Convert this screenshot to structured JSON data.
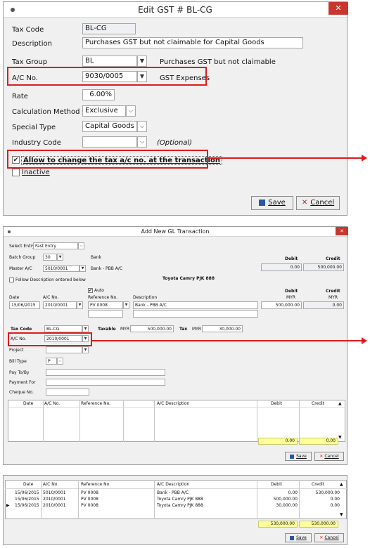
{
  "dialog1": {
    "title": "Edit GST # BL-CG",
    "close": "✕",
    "tax_code_label": "Tax Code",
    "tax_code_value": "BL-CG",
    "description_label": "Description",
    "description_value": "Purchases GST but not claimable for Capital Goods",
    "tax_group_label": "Tax Group",
    "tax_group_value": "BL",
    "tax_group_desc": "Purchases GST but not claimable",
    "ac_no_label": "A/C No.",
    "ac_no_value": "9030/0005",
    "ac_no_desc": "GST Expenses",
    "rate_label": "Rate",
    "rate_value": "6.00%",
    "calc_label": "Calculation Method",
    "calc_value": "Exclusive",
    "special_label": "Special Type",
    "special_value": "Capital Goods",
    "industry_label": "Industry Code",
    "industry_value": "",
    "optional": "(Optional)",
    "allow_change_label": "Allow to change the tax a/c no. at the transaction",
    "allow_change_checked": "✔",
    "inactive_label": "Inactive",
    "save_label": "Save",
    "cancel_label": "Cancel"
  },
  "dialog2": {
    "title": "Add New GL Transaction",
    "close": "✕",
    "select_entry_label": "Select Entry",
    "select_entry_value": "Fast Entry",
    "batch_group_label": "Batch Group",
    "batch_group_value": "30",
    "batch_group_desc": "Bank",
    "master_ac_label": "Master A/C",
    "master_ac_value": "5010/0001",
    "master_ac_desc": "Bank - PBB A/C",
    "debit_hdr": "Debit",
    "credit_hdr": "Credit",
    "debit_total": "0.00",
    "credit_total": "500,000.00",
    "follow_desc_label": "Follow Description entered below",
    "ref_caption": "Toyota Camry PJK 888",
    "auto_label": "Auto",
    "date_label": "Date",
    "ac_no_label": "A/C No.",
    "ref_no_label": "Reference No.",
    "desc_label": "Description",
    "debit_label": "Debit",
    "credit_label": "Credit",
    "myr1": "MYR",
    "myr2": "MYR",
    "date_value": "15/06/2015",
    "ac_value": "2010/0001",
    "ref_value": "PV 0008",
    "desc_value": "Bank - PBB A/C",
    "debit_value": "500,000.00",
    "credit_value": "0.00",
    "tax_code_label": "Tax Code",
    "tax_code_value": "BL-CG",
    "taxable_label": "Taxable",
    "taxable_cur": "MYR",
    "taxable_value": "500,000.00",
    "tax_label": "Tax",
    "tax_cur": "MYR",
    "tax_value": "30,000.00",
    "tax_ac_label": "A/C No.",
    "tax_ac_value": "2010/0001",
    "project_label": "Project",
    "bill_type_label": "Bill Type",
    "bill_type_value": "P",
    "pay_to_label": "Pay To/By",
    "payment_for_label": "Payment For",
    "cheque_label": "Cheque No.",
    "grid_headers": [
      "Date",
      "A/C No.",
      "Reference No.",
      "A/C Description",
      "Debit",
      "Credit"
    ],
    "grid_total_debit": "0.00",
    "grid_total_credit": "0.00",
    "save_label": "Save",
    "cancel_label": "Cancel"
  },
  "dialog3": {
    "headers": [
      "Date",
      "A/C No.",
      "Reference No.",
      "A/C Description",
      "Debit",
      "Credit"
    ],
    "rows": [
      [
        "15/06/2015",
        "5010/0001",
        "PV 0008",
        "Bank - PBB A/C",
        "0.00",
        "530,000.00"
      ],
      [
        "15/06/2015",
        "2010/0001",
        "PV 0008",
        "Toyota Camry PJK 888",
        "500,000.00",
        "0.00"
      ],
      [
        "15/06/2015",
        "2010/0001",
        "PV 0008",
        "Toyota Camry PJK 888",
        "30,000.00",
        "0.00"
      ]
    ],
    "total_debit": "530,000.00",
    "total_credit": "530,000.00",
    "save_label": "Save",
    "cancel_label": "Cancel"
  },
  "colors": {
    "highlight": "#e01b1b",
    "close": "#c7372f",
    "totals": "#ffff99"
  }
}
